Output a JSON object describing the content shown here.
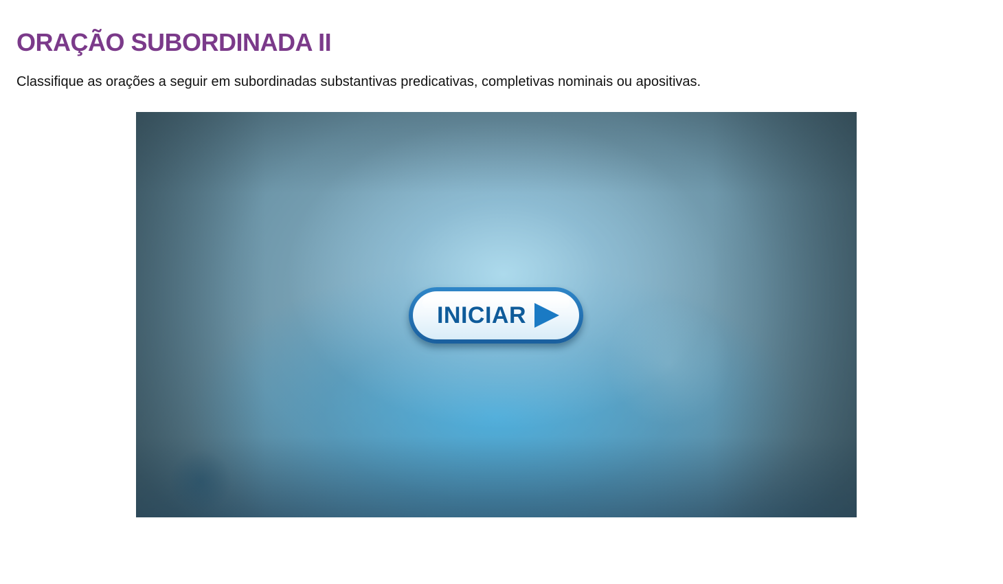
{
  "page": {
    "title": "ORAÇÃO SUBORDINADA II",
    "instruction": "Classifique as orações a seguir em subordinadas substantivas predicativas, completivas nominais ou apositivas."
  },
  "activity": {
    "start_button": {
      "label": "INICIAR",
      "icon": "play-icon"
    }
  },
  "colors": {
    "title": "#7b3a8a",
    "button_text": "#0e5b9a",
    "button_border": "#1a5f9e"
  }
}
